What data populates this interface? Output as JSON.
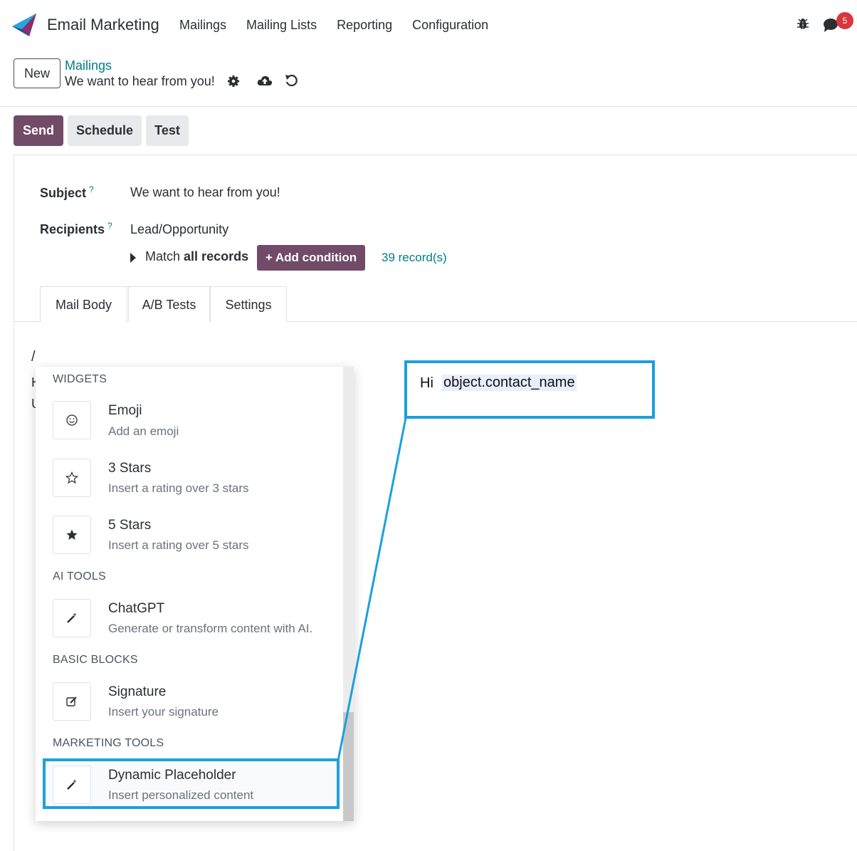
{
  "navbar": {
    "app_name": "Email Marketing",
    "menu": [
      "Mailings",
      "Mailing Lists",
      "Reporting",
      "Configuration"
    ],
    "notification_count": "5"
  },
  "control": {
    "new_label": "New",
    "breadcrumb_parent": "Mailings",
    "breadcrumb_current": "We want to hear from you!"
  },
  "actions": {
    "send": "Send",
    "schedule": "Schedule",
    "test": "Test"
  },
  "form": {
    "subject_label": "Subject",
    "subject_value": "We want to hear from you!",
    "recipients_label": "Recipients",
    "recipients_value": "Lead/Opportunity",
    "match_prefix": "Match",
    "match_bold": "all records",
    "add_condition": "Add condition",
    "records_count": "39 record(s)",
    "help_mark": "?"
  },
  "tabs": [
    "Mail Body",
    "A/B Tests",
    "Settings"
  ],
  "editor": {
    "typed": "/",
    "line2": "H",
    "line3": "U"
  },
  "powerbox": {
    "categories": {
      "widgets": "WIDGETS",
      "ai_tools": "AI TOOLS",
      "basic_blocks": "BASIC BLOCKS",
      "marketing_tools": "MARKETING TOOLS"
    },
    "items": [
      {
        "title": "Emoji",
        "desc": "Add an emoji",
        "icon": "smile-icon"
      },
      {
        "title": "3 Stars",
        "desc": "Insert a rating over 3 stars",
        "icon": "star-outline-icon"
      },
      {
        "title": "5 Stars",
        "desc": "Insert a rating over 5 stars",
        "icon": "star-filled-icon"
      },
      {
        "title": "ChatGPT",
        "desc": "Generate or transform content with AI.",
        "icon": "magic-wand-icon"
      },
      {
        "title": "Signature",
        "desc": "Insert your signature",
        "icon": "edit-icon"
      },
      {
        "title": "Dynamic Placeholder",
        "desc": "Insert personalized content",
        "icon": "magic-wand-icon"
      }
    ]
  },
  "callout": {
    "greeting": "Hi",
    "placeholder": "object.contact_name"
  },
  "colors": {
    "primary": "#714b67",
    "link": "#017e84",
    "highlight": "#1ba0dc",
    "badge": "#d9363e"
  }
}
